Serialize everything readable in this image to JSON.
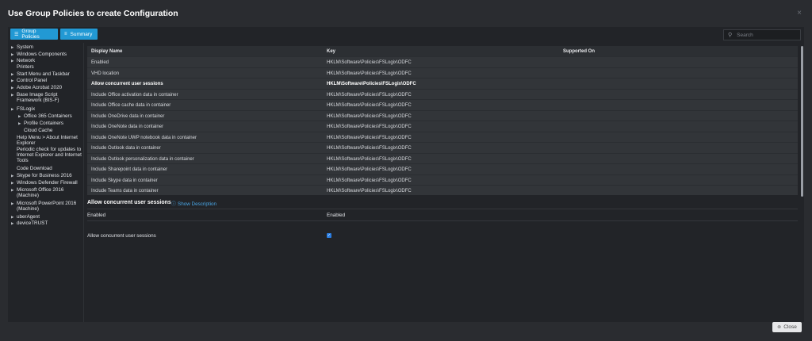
{
  "dialog": {
    "title": "Use Group Policies to create Configuration",
    "close_glyph": "×"
  },
  "toolbar": {
    "group_policies_label": "Group Policies",
    "summary_label": "Summary",
    "search_placeholder": "Search"
  },
  "sidebar": {
    "items": [
      {
        "label": "System",
        "arrow": true
      },
      {
        "label": "Windows Components",
        "arrow": true
      },
      {
        "label": "Network",
        "arrow": true
      },
      {
        "label": "Printers",
        "arrow": false
      },
      {
        "label": "Start Menu and Taskbar",
        "arrow": true
      },
      {
        "label": "Control Panel",
        "arrow": true
      },
      {
        "label": "Adobe Acrobat 2020",
        "arrow": true
      },
      {
        "label": "Base Image Script Framework (BIS-F)",
        "arrow": true
      },
      {
        "label": "FSLogix",
        "arrow": true
      },
      {
        "label": "Office 365 Containers",
        "arrow": true
      },
      {
        "label": "Profile Containers",
        "arrow": true
      },
      {
        "label": "Cloud Cache",
        "arrow": false
      },
      {
        "label": "Help Menu > About Internet Explorer",
        "arrow": false
      },
      {
        "label": "Periodic check for updates to Internet Explorer and Internet Tools",
        "arrow": false
      },
      {
        "label": "Code Download",
        "arrow": false
      },
      {
        "label": "Skype for Business 2016",
        "arrow": true
      },
      {
        "label": "Windows Defender Firewall",
        "arrow": true
      },
      {
        "label": "Microsoft Office 2016 (Machine)",
        "arrow": true
      },
      {
        "label": "Microsoft PowerPoint 2016 (Machine)",
        "arrow": true
      },
      {
        "label": "uberAgent",
        "arrow": true
      },
      {
        "label": "deviceTRUST",
        "arrow": true
      }
    ]
  },
  "table": {
    "headers": {
      "display_name": "Display Name",
      "key": "Key",
      "supported_on": "Supported On"
    },
    "rows": [
      {
        "name": "Enabled",
        "key": "HKLM\\Software\\Policies\\FSLogix\\ODFC",
        "supported": ""
      },
      {
        "name": "VHD location",
        "key": "HKLM\\Software\\Policies\\FSLogix\\ODFC",
        "supported": ""
      },
      {
        "name": "Allow concurrent user sessions",
        "key": "HKLM\\Software\\Policies\\FSLogix\\ODFC",
        "supported": ""
      },
      {
        "name": "Include Office activation data in container",
        "key": "HKLM\\Software\\Policies\\FSLogix\\ODFC",
        "supported": ""
      },
      {
        "name": "Include Office cache data in container",
        "key": "HKLM\\Software\\Policies\\FSLogix\\ODFC",
        "supported": ""
      },
      {
        "name": "Include OneDrive data in container",
        "key": "HKLM\\Software\\Policies\\FSLogix\\ODFC",
        "supported": ""
      },
      {
        "name": "Include OneNote data in container",
        "key": "HKLM\\Software\\Policies\\FSLogix\\ODFC",
        "supported": ""
      },
      {
        "name": "Include OneNote UWP notebook data in container",
        "key": "HKLM\\Software\\Policies\\FSLogix\\ODFC",
        "supported": ""
      },
      {
        "name": "Include Outlook data in container",
        "key": "HKLM\\Software\\Policies\\FSLogix\\ODFC",
        "supported": ""
      },
      {
        "name": "Include Outlook personalization data in container",
        "key": "HKLM\\Software\\Policies\\FSLogix\\ODFC",
        "supported": ""
      },
      {
        "name": "Include Sharepoint data in container",
        "key": "HKLM\\Software\\Policies\\FSLogix\\ODFC",
        "supported": ""
      },
      {
        "name": "Include Skype data in container",
        "key": "HKLM\\Software\\Policies\\FSLogix\\ODFC",
        "supported": ""
      },
      {
        "name": "Include Teams data in container",
        "key": "HKLM\\Software\\Policies\\FSLogix\\ODFC",
        "supported": ""
      }
    ],
    "selected_index": 2
  },
  "details": {
    "title": "Allow concurrent user sessions",
    "show_description_label": "Show Description",
    "fields": [
      {
        "label": "Enabled",
        "value": "Enabled"
      },
      {
        "label": "Allow concurrent user sessions",
        "checked": true
      }
    ]
  },
  "footer": {
    "close_label": "Close"
  },
  "colors": {
    "accent": "#2299d4",
    "background": "#2a2c30",
    "panel": "#222428",
    "table": "#323539"
  }
}
